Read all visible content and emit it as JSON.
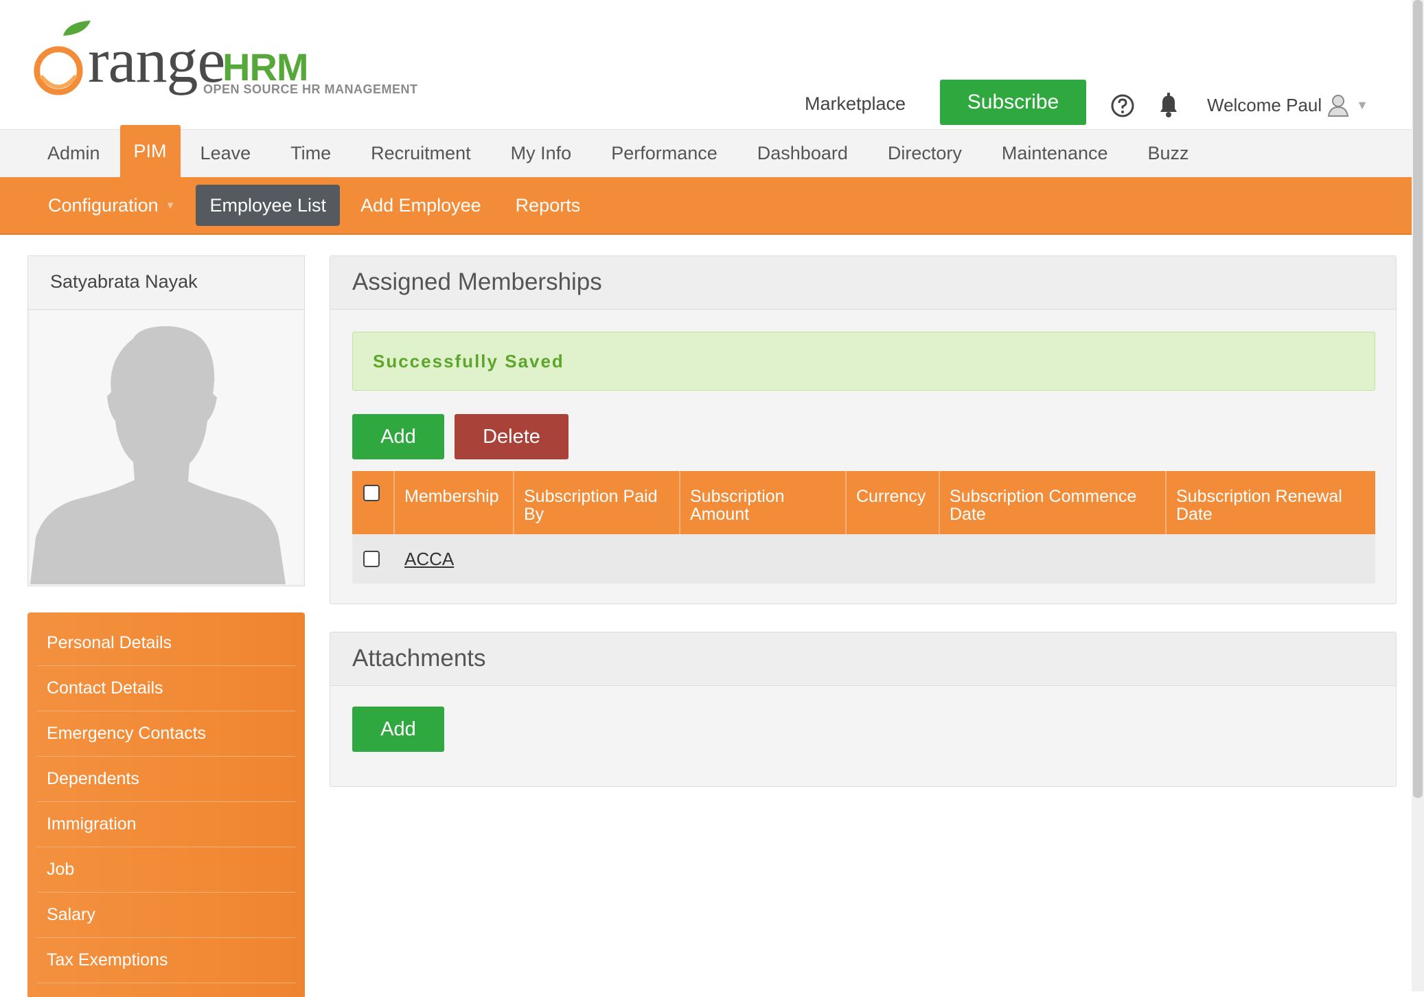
{
  "logo": {
    "word_orange_rest": "range",
    "word_hrm": "HRM",
    "tagline": "OPEN SOURCE HR MANAGEMENT",
    "colors": {
      "orange": "#f28c38",
      "green": "#56a83a"
    }
  },
  "topbar": {
    "marketplace": "Marketplace",
    "subscribe": "Subscribe",
    "help_icon": "help-circle-icon",
    "bell_icon": "bell-icon",
    "welcome": "Welcome Paul"
  },
  "main_nav": {
    "items": [
      {
        "label": "Admin"
      },
      {
        "label": "PIM",
        "active": true
      },
      {
        "label": "Leave"
      },
      {
        "label": "Time"
      },
      {
        "label": "Recruitment"
      },
      {
        "label": "My Info"
      },
      {
        "label": "Performance"
      },
      {
        "label": "Dashboard"
      },
      {
        "label": "Directory"
      },
      {
        "label": "Maintenance"
      },
      {
        "label": "Buzz"
      }
    ]
  },
  "sub_nav": {
    "items": [
      {
        "label": "Configuration",
        "dropdown": true
      },
      {
        "label": "Employee List",
        "active": true
      },
      {
        "label": "Add Employee"
      },
      {
        "label": "Reports"
      }
    ]
  },
  "profile": {
    "name": "Satyabrata Nayak",
    "photo_icon": "person-silhouette-icon"
  },
  "side_menu": {
    "items": [
      "Personal Details",
      "Contact Details",
      "Emergency Contacts",
      "Dependents",
      "Immigration",
      "Job",
      "Salary",
      "Tax Exemptions"
    ]
  },
  "memberships": {
    "title": "Assigned Memberships",
    "message": "Successfully Saved",
    "add_label": "Add",
    "delete_label": "Delete",
    "columns": [
      "Membership",
      "Subscription Paid By",
      "Subscription Amount",
      "Currency",
      "Subscription Commence Date",
      "Subscription Renewal Date"
    ],
    "rows": [
      {
        "membership": "ACCA",
        "paid_by": "",
        "amount": "",
        "currency": "",
        "commence": "",
        "renewal": ""
      }
    ]
  },
  "attachments": {
    "title": "Attachments",
    "add_label": "Add"
  },
  "colors": {
    "accent": "#f28c38",
    "success_green": "#2ea83f",
    "delete_red": "#a9433a",
    "active_subnav": "#555a60"
  }
}
